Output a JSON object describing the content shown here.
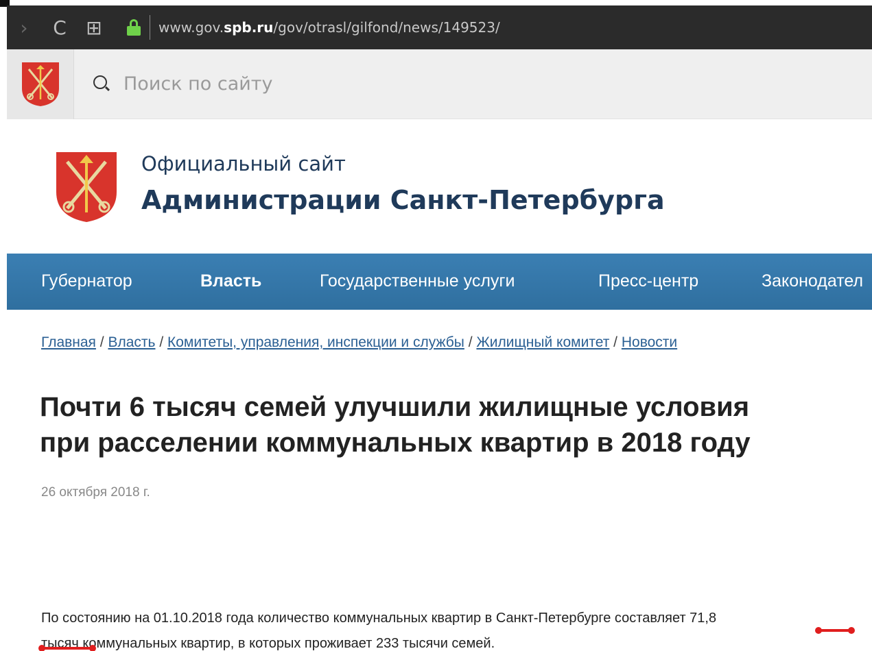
{
  "browser": {
    "url_prefix": "www.gov.",
    "url_domain": "spb.ru",
    "url_path": "/gov/otrasl/gilfond/news/149523/",
    "back_glyph": "›",
    "reload_glyph": "C",
    "grid_glyph": "⊞"
  },
  "search": {
    "placeholder": "Поиск по сайту"
  },
  "site": {
    "title_line1": "Официальный сайт",
    "title_line2": "Администрации Санкт-Петербурга"
  },
  "nav": {
    "items": [
      {
        "label": "Губернатор"
      },
      {
        "label": "Власть"
      },
      {
        "label": "Государственные услуги"
      },
      {
        "label": "Пресс-центр"
      },
      {
        "label": "Законодател"
      }
    ]
  },
  "breadcrumb": {
    "items": [
      {
        "label": "Главная"
      },
      {
        "label": "Власть"
      },
      {
        "label": "Комитеты, управления, инспекции и службы"
      },
      {
        "label": "Жилищный комитет"
      },
      {
        "label": "Новости"
      }
    ],
    "separator": "/"
  },
  "article": {
    "title_line1": "Почти 6 тысяч семей улучшили жилищные условия",
    "title_line2": "при расселении коммунальных квартир в 2018 году",
    "date": "26 октября 2018 г.",
    "paragraph_line1": "По состоянию на 01.10.2018 года количество коммунальных квартир в Санкт-Петербурге составляет 71,8",
    "paragraph_line2": "тысяч коммунальных квартир, в которых проживает 233 тысячи семей."
  },
  "colors": {
    "nav_bg": "#3b7fb3",
    "heading": "#1f3a5a",
    "link": "#2a5f93",
    "annotation": "#e01e1e",
    "coat_red": "#d8342c"
  }
}
